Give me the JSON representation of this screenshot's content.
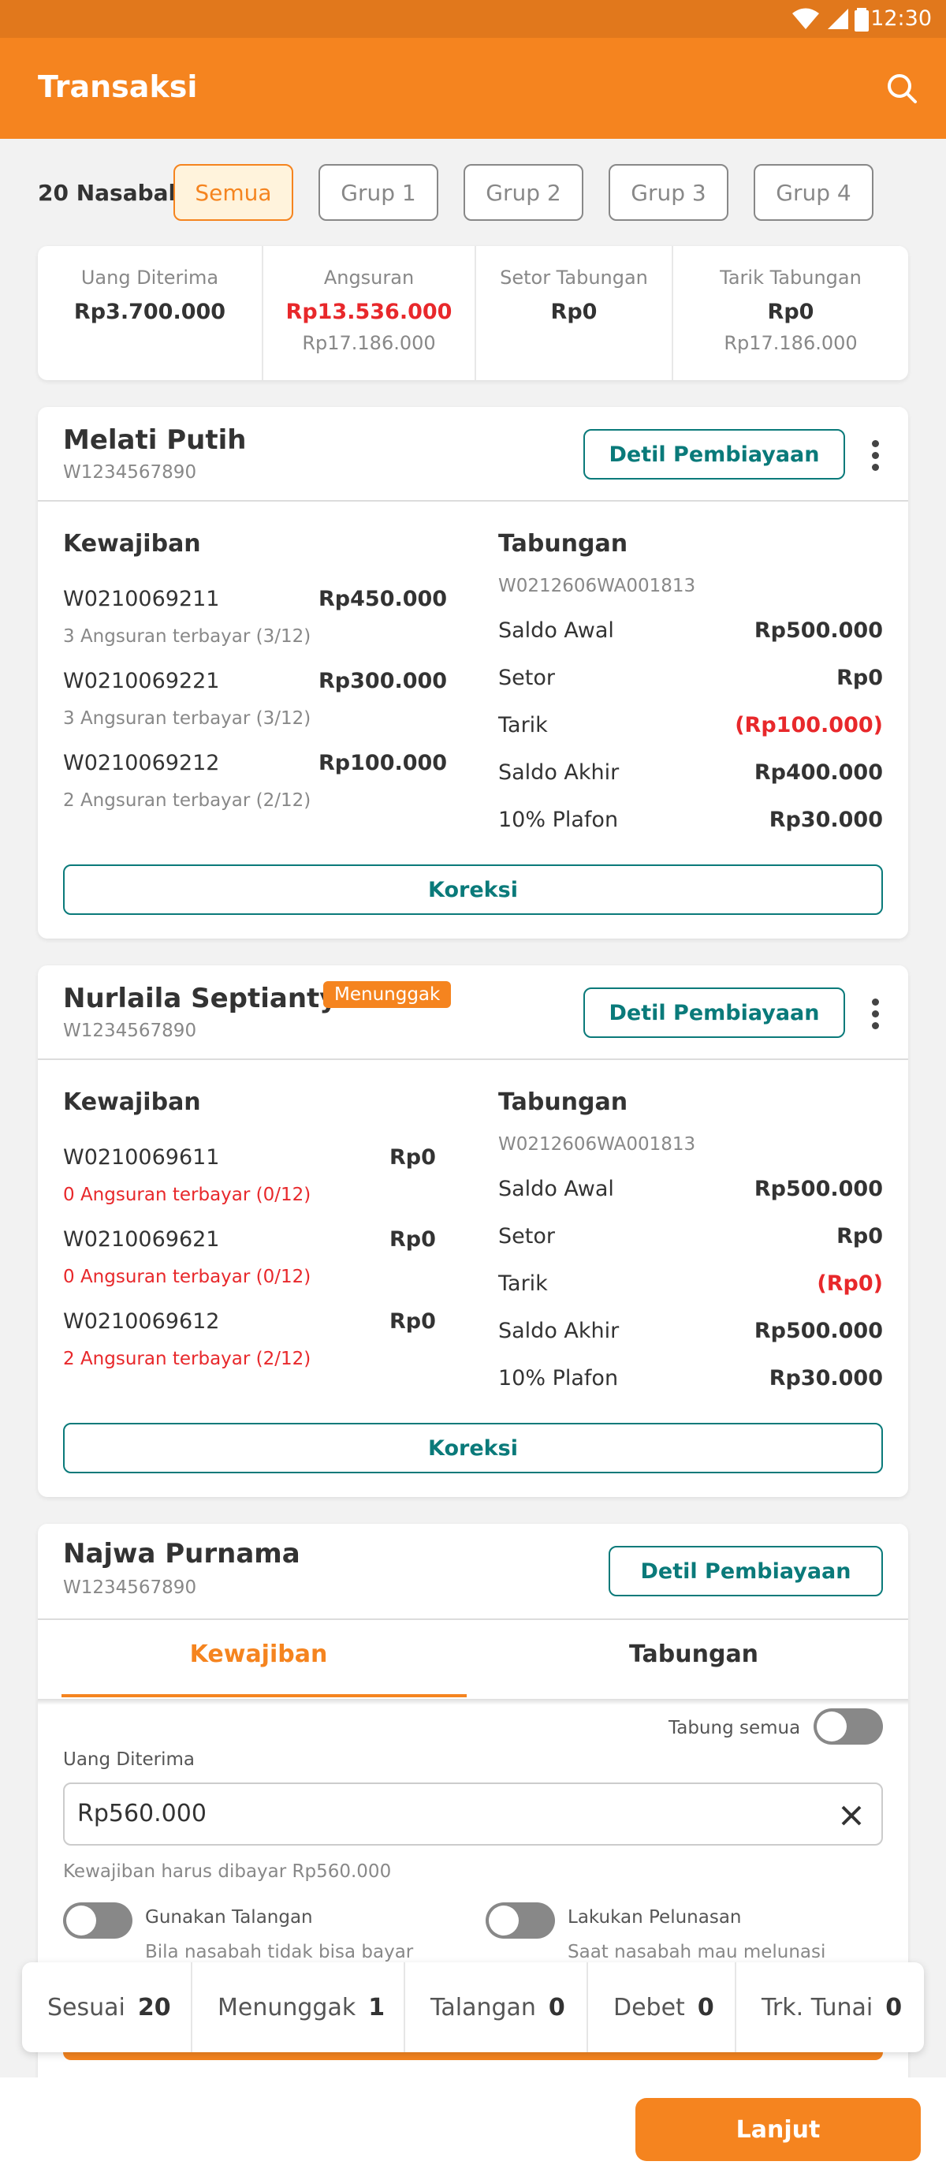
{
  "status": {
    "time": "12:30"
  },
  "appbar": {
    "title": "Transaksi"
  },
  "filter": {
    "count": "20 Nasabah",
    "chips": [
      "Semua",
      "Grup 1",
      "Grup 2",
      "Grup 3",
      "Grup 4"
    ]
  },
  "summary": [
    {
      "label": "Uang Diterima",
      "value": "Rp3.700.000",
      "sub": ""
    },
    {
      "label": "Angsuran",
      "value": "Rp13.536.000",
      "sub": "Rp17.186.000"
    },
    {
      "label": "Setor Tabungan",
      "value": "Rp0",
      "sub": ""
    },
    {
      "label": "Tarik Tabungan",
      "value": "Rp0",
      "sub": "Rp17.186.000"
    }
  ],
  "labels": {
    "detail_btn": "Detil Pembiayaan",
    "kewajiban": "Kewajiban",
    "tabungan": "Tabungan",
    "koreksi": "Koreksi",
    "saldo_awal": "Saldo Awal",
    "setor": "Setor",
    "tarik": "Tarik",
    "saldo_akhir": "Saldo Akhir",
    "plafon": "10% Plafon"
  },
  "customers": [
    {
      "name": "Melati Putih",
      "acct": "W1234567890",
      "loans": [
        {
          "id": "W0210069211",
          "amount": "Rp450.000",
          "note": "3 Angsuran terbayar  (3/12)"
        },
        {
          "id": "W0210069221",
          "amount": "Rp300.000",
          "note": "3 Angsuran terbayar  (3/12)"
        },
        {
          "id": "W0210069212",
          "amount": "Rp100.000",
          "note": "2 Angsuran terbayar  (2/12)"
        }
      ],
      "savings": {
        "acct": "W0212606WA001813",
        "saldo_awal": "Rp500.000",
        "setor": "Rp0",
        "tarik": "(Rp100.000)",
        "saldo_akhir": "Rp400.000",
        "plafon": "Rp30.000"
      }
    },
    {
      "name": "Nurlaila Septianty",
      "badge": "Menunggak",
      "acct": "W1234567890",
      "loans": [
        {
          "id": "W0210069611",
          "amount": "Rp0",
          "note": "0 Angsuran terbayar  (0/12)"
        },
        {
          "id": "W0210069621",
          "amount": "Rp0",
          "note": "0 Angsuran terbayar  (0/12)"
        },
        {
          "id": "W0210069612",
          "amount": "Rp0",
          "note": "2 Angsuran terbayar  (2/12)"
        }
      ],
      "savings": {
        "acct": "W0212606WA001813",
        "saldo_awal": "Rp500.000",
        "setor": "Rp0",
        "tarik": "(Rp0)",
        "saldo_akhir": "Rp500.000",
        "plafon": "Rp30.000"
      }
    },
    {
      "name": "Najwa Purnama",
      "acct": "W1234567890"
    }
  ],
  "form": {
    "tabs": [
      "Kewajiban",
      "Tabungan"
    ],
    "tabung_semua": "Tabung semua",
    "uang_diterima_label": "Uang Diterima",
    "uang_diterima_value": "Rp560.000",
    "hint": "Kewajiban harus dibayar Rp560.000",
    "talangan": {
      "label": "Gunakan Talangan",
      "sub": "Bila nasabah tidak bisa bayar"
    },
    "pelunasan": {
      "label": "Lakukan Pelunasan",
      "sub": "Saat nasabah mau melunasi"
    }
  },
  "stats": [
    {
      "label": "Sesuai",
      "value": "20"
    },
    {
      "label": "Menunggak",
      "value": "1"
    },
    {
      "label": "Talangan",
      "value": "0"
    },
    {
      "label": "Debet",
      "value": "0"
    },
    {
      "label": "Trk. Tunai",
      "value": "0"
    }
  ],
  "footer": {
    "next": "Lanjut"
  },
  "colors": {
    "primary": "#f5841f",
    "teal": "#0a7a7a",
    "red": "#e8282b"
  }
}
